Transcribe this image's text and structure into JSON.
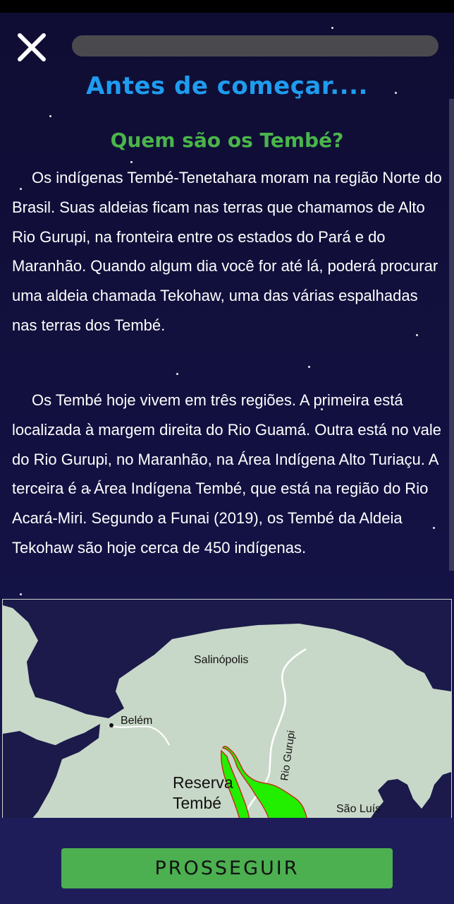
{
  "header": {
    "close_icon": "close-icon",
    "progress": 0.0
  },
  "title": "Antes de começar....",
  "section": {
    "heading": "Quem são os Tembé?",
    "paragraphs": [
      "Os indígenas Tembé-Tenetahara moram na região Norte do Brasil. Suas aldeias ficam nas terras que chamamos de Alto Rio Gurupi, na fronteira entre os estados do Pará e do Maranhão. Quando algum dia você for até lá, poderá procurar uma aldeia chamada Tekohaw, uma das várias espalhadas nas terras dos Tembé.",
      "Os Tembé hoje vivem em três regiões. A primeira está localizada à margem direita do Rio Guamá. Outra está no vale do Rio Gurupi, no Maranhão, na Área Indígena Alto Turiaçu. A terceira é a Área Indígena Tembé, que está na região do Rio Acará-Miri. Segundo a Funai (2019), os Tembé da Aldeia Tekohaw são hoje cerca de 450 indígenas."
    ]
  },
  "map": {
    "labels": {
      "salinopolis": "Salinópolis",
      "belem": "Belém",
      "river": "Rio Gurupi",
      "reserve_line1": "Reserva",
      "reserve_line2": "Tembé",
      "sao_luis": "São Luís"
    },
    "colors": {
      "land": "#c8d8c8",
      "water": "#1b1a4a",
      "reserve": "#22ee00",
      "reserve_border": "#c0341c"
    }
  },
  "footer": {
    "continue_label": "PROSSEGUIR"
  },
  "colors": {
    "background": "#121038",
    "title": "#1e9cf0",
    "heading": "#4ab54a",
    "button": "#4caf50"
  }
}
